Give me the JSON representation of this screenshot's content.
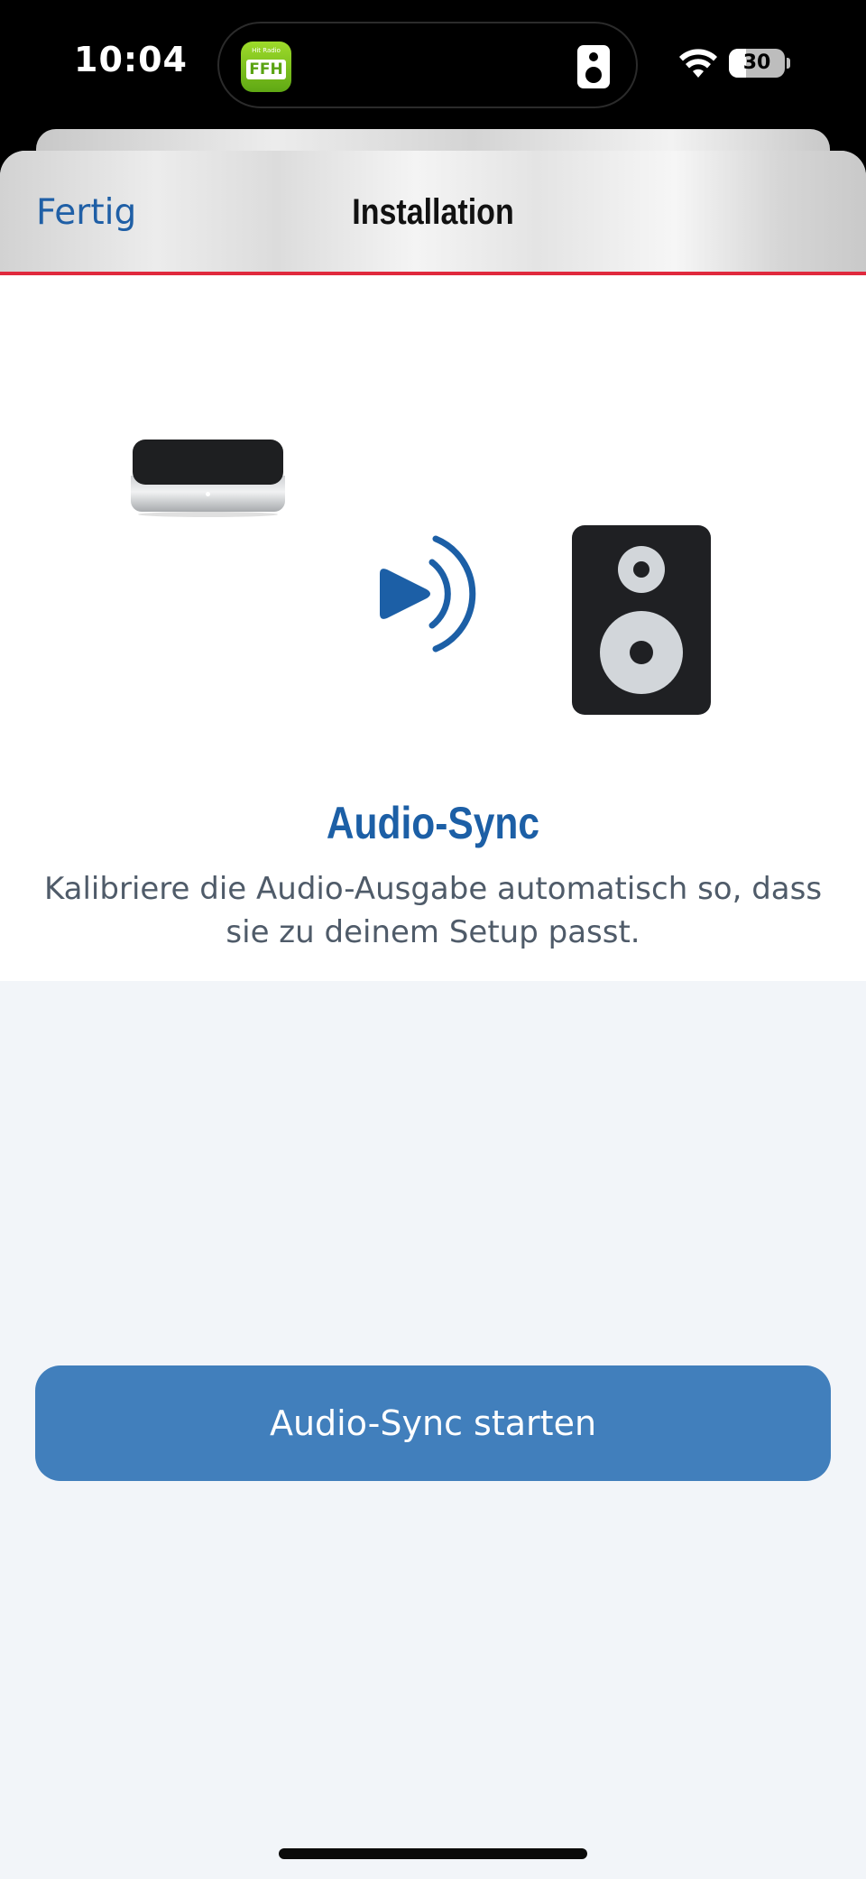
{
  "status_bar": {
    "time": "10:04",
    "battery_level": "30",
    "battery_fraction": 0.3,
    "live_activity": {
      "app_icon_small_text": "Hit Radio",
      "app_icon_text": "FFH",
      "app_icon": "ffh-app-icon",
      "trailing_icon": "speaker-icon"
    },
    "icons": [
      "wifi-icon",
      "battery-icon"
    ]
  },
  "nav_bar": {
    "done_label": "Fertig",
    "title": "Installation",
    "accent_line_color": "#e0293d"
  },
  "illustration": {
    "icons": [
      "set-top-box-icon",
      "sound-wave-icon",
      "speaker-icon"
    ],
    "accent_color": "#1c5fa6"
  },
  "feature": {
    "title": "Audio-Sync",
    "description": "Kalibriere die Audio-Ausgabe automatisch so, dass sie zu deinem Setup passt."
  },
  "actions": {
    "start_button_label": "Audio-Sync starten",
    "button_color": "#417fbc"
  }
}
